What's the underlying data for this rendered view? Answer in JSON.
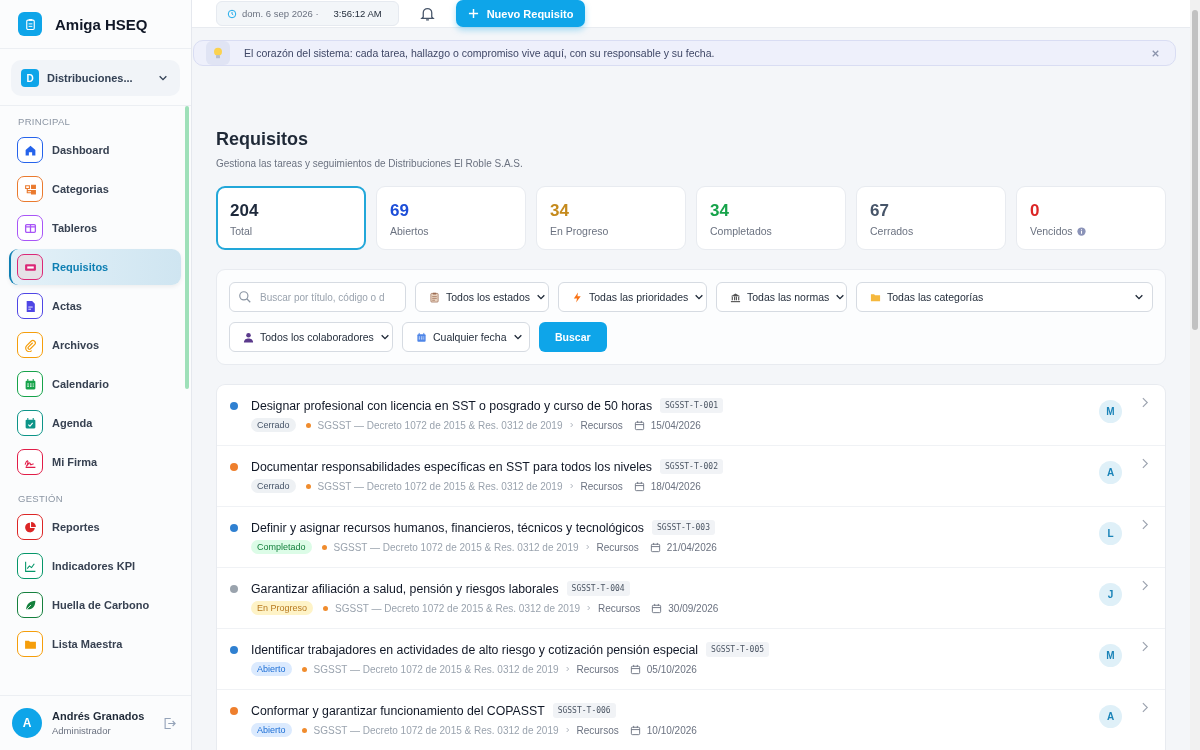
{
  "app": {
    "name": "Amiga HSEQ"
  },
  "company": {
    "initial": "D",
    "name": "Distribuciones..."
  },
  "sidebar": {
    "sections": [
      {
        "title": "PRINCIPAL",
        "items": [
          {
            "label": "Dashboard",
            "color": "#2563eb",
            "selected": false
          },
          {
            "label": "Categorias",
            "color": "#ea7a2e",
            "selected": false
          },
          {
            "label": "Tableros",
            "color": "#a855f7",
            "selected": false
          },
          {
            "label": "Requisitos",
            "color": "#db2777",
            "selected": true
          },
          {
            "label": "Actas",
            "color": "#4f46e5",
            "selected": false
          },
          {
            "label": "Archivos",
            "color": "#f59e0b",
            "selected": false
          },
          {
            "label": "Calendario",
            "color": "#16a34a",
            "selected": false
          },
          {
            "label": "Agenda",
            "color": "#0d9488",
            "selected": false
          },
          {
            "label": "Mi Firma",
            "color": "#e11d48",
            "selected": false
          }
        ]
      },
      {
        "title": "GESTIÓN",
        "items": [
          {
            "label": "Reportes",
            "color": "#dc2626",
            "selected": false
          },
          {
            "label": "Indicadores KPI",
            "color": "#059669",
            "selected": false
          },
          {
            "label": "Huella de Carbono",
            "color": "#15803d",
            "selected": false
          },
          {
            "label": "Lista Maestra",
            "color": "#f59e0b",
            "selected": false
          }
        ]
      }
    ]
  },
  "user": {
    "initial": "A",
    "name": "Andrés Granados",
    "role": "Administrador"
  },
  "topbar": {
    "date": "dom. 6 sep 2026 ·",
    "time": "3:56:12 AM",
    "new_button": "Nuevo Requisito"
  },
  "banner": {
    "text": "El corazón del sistema: cada tarea, hallazgo o compromiso vive aquí, con su responsable y su fecha."
  },
  "page": {
    "title": "Requisitos",
    "subtitle": "Gestiona las tareas y seguimientos de Distribuciones El Roble S.A.S."
  },
  "stats": [
    {
      "value": "204",
      "label": "Total",
      "color": "#1e293b",
      "selected": true,
      "info": false
    },
    {
      "value": "69",
      "label": "Abiertos",
      "color": "#1d4ed8",
      "selected": false,
      "info": false
    },
    {
      "value": "34",
      "label": "En Progreso",
      "color": "#c58a1c",
      "selected": false,
      "info": false
    },
    {
      "value": "34",
      "label": "Completados",
      "color": "#16a34a",
      "selected": false,
      "info": false
    },
    {
      "value": "67",
      "label": "Cerrados",
      "color": "#475569",
      "selected": false,
      "info": false
    },
    {
      "value": "0",
      "label": "Vencidos",
      "color": "#dc2626",
      "selected": false,
      "info": true
    }
  ],
  "filters": {
    "search": {
      "placeholder": "Buscar por título, código o d"
    },
    "selects": [
      {
        "label": "Todos los estados"
      },
      {
        "label": "Todas las prioridades"
      },
      {
        "label": "Todas las normas"
      },
      {
        "label": "Todas las categorías"
      },
      {
        "label": "Todos los colaboradores"
      },
      {
        "label": "Cualquier fecha"
      }
    ],
    "button": "Buscar"
  },
  "requirements": [
    {
      "title": "Designar profesional con licencia en SST o posgrado y curso de 50 horas",
      "code": "SGSST-T-001",
      "color": "#2f80d1",
      "status": {
        "label": "Cerrado",
        "kind": "closed"
      },
      "norm": "SGSST — Decreto 1072 de 2015 & Res. 0312 de 2019",
      "category": "Recursos",
      "date": "15/04/2026",
      "assignee": "M"
    },
    {
      "title": "Documentar responsabilidades específicas en SST para todos los niveles",
      "code": "SGSST-T-002",
      "color": "#ee7f2d",
      "status": {
        "label": "Cerrado",
        "kind": "closed"
      },
      "norm": "SGSST — Decreto 1072 de 2015 & Res. 0312 de 2019",
      "category": "Recursos",
      "date": "18/04/2026",
      "assignee": "A"
    },
    {
      "title": "Definir y asignar recursos humanos, financieros, técnicos y tecnológicos",
      "code": "SGSST-T-003",
      "color": "#2f80d1",
      "status": {
        "label": "Completado",
        "kind": "done"
      },
      "norm": "SGSST — Decreto 1072 de 2015 & Res. 0312 de 2019",
      "category": "Recursos",
      "date": "21/04/2026",
      "assignee": "L"
    },
    {
      "title": "Garantizar afiliación a salud, pensión y riesgos laborales",
      "code": "SGSST-T-004",
      "color": "#9aa3ad",
      "status": {
        "label": "En Progreso",
        "kind": "progress"
      },
      "norm": "SGSST — Decreto 1072 de 2015 & Res. 0312 de 2019",
      "category": "Recursos",
      "date": "30/09/2026",
      "assignee": "J"
    },
    {
      "title": "Identificar trabajadores en actividades de alto riesgo y cotización pensión especial",
      "code": "SGSST-T-005",
      "color": "#2f80d1",
      "status": {
        "label": "Abierto",
        "kind": "open"
      },
      "norm": "SGSST — Decreto 1072 de 2015 & Res. 0312 de 2019",
      "category": "Recursos",
      "date": "05/10/2026",
      "assignee": "M"
    },
    {
      "title": "Conformar y garantizar funcionamiento del COPASST",
      "code": "SGSST-T-006",
      "color": "#ee7f2d",
      "status": {
        "label": "Abierto",
        "kind": "open"
      },
      "norm": "SGSST — Decreto 1072 de 2015 & Res. 0312 de 2019",
      "category": "Recursos",
      "date": "10/10/2026",
      "assignee": "A"
    }
  ]
}
